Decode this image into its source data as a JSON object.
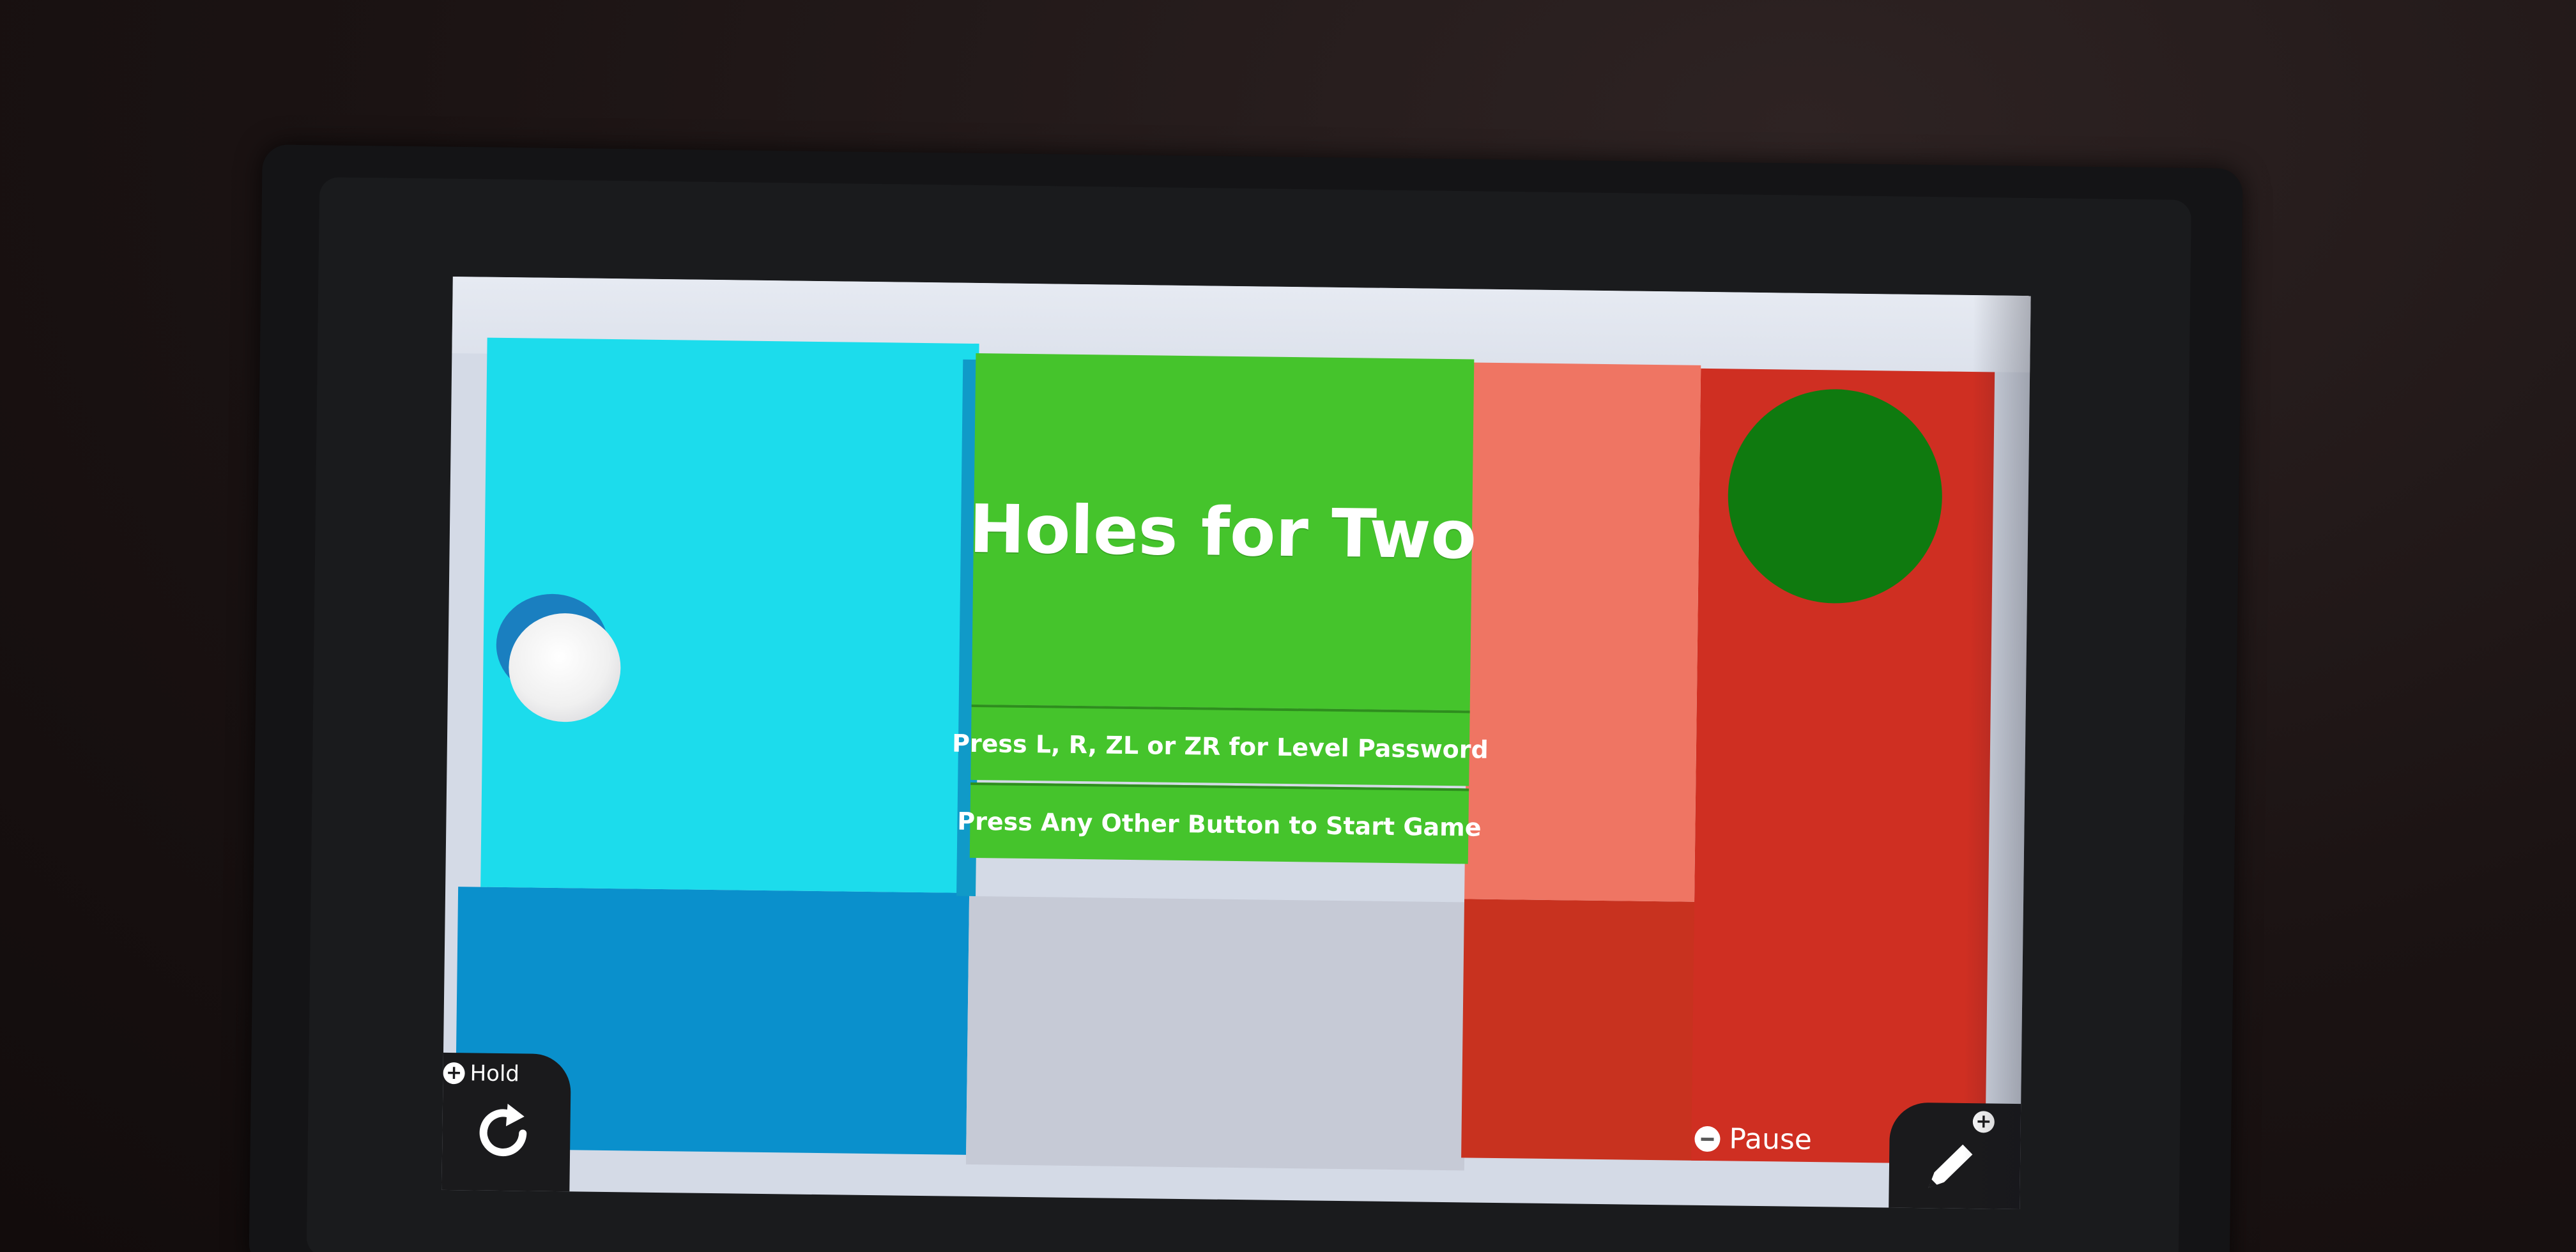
{
  "game": {
    "title": "Holes for Two",
    "menu": {
      "password_option": "Press L, R, ZL or ZR for Level Password",
      "start_option": "Press Any Other Button to Start Game"
    }
  },
  "hud": {
    "hold_label": "Hold",
    "hold_button_symbol": "+",
    "restart_icon": "restart-icon",
    "pause_label": "Pause",
    "pause_button_symbol": "−",
    "edit_button_symbol": "+",
    "edit_icon": "pencil-icon"
  },
  "colors": {
    "menu_green": "#45c42c",
    "hole_green": "#0f7a0f",
    "cyan_tile": "#1cdcec",
    "red_tile": "#cf2f22",
    "salmon_tile": "#ef7563"
  }
}
